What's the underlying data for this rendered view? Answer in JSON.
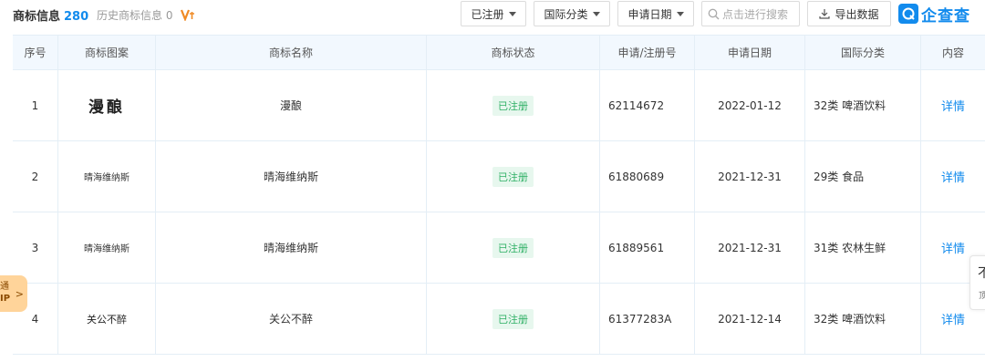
{
  "header": {
    "tab_active_label": "商标信息",
    "tab_active_count": "280",
    "tab_history_label": "历史商标信息 0",
    "filter_status": "已注册",
    "filter_class": "国际分类",
    "filter_date": "申请日期",
    "search_placeholder": "点击进行搜索",
    "export_label": "导出数据",
    "brand_name": "企查查"
  },
  "columns": [
    "序号",
    "商标图案",
    "商标名称",
    "商标状态",
    "申请/注册号",
    "申请日期",
    "国际分类",
    "内容"
  ],
  "rows": [
    {
      "index": "1",
      "image_text": "漫酿",
      "name": "漫酿",
      "status": "已注册",
      "reg_no": "62114672",
      "date": "2022-01-12",
      "class": "32类 啤酒饮料",
      "action": "详情"
    },
    {
      "index": "2",
      "image_text": "晴海维纳斯",
      "name": "晴海维纳斯",
      "status": "已注册",
      "reg_no": "61880689",
      "date": "2021-12-31",
      "class": "29类 食品",
      "action": "详情"
    },
    {
      "index": "3",
      "image_text": "晴海维纳斯",
      "name": "晴海维纳斯",
      "status": "已注册",
      "reg_no": "61889561",
      "date": "2021-12-31",
      "class": "31类 农林生鲜",
      "action": "详情"
    },
    {
      "index": "4",
      "image_text": "关公不醉",
      "name": "关公不醉",
      "status": "已注册",
      "reg_no": "61377283A",
      "date": "2021-12-14",
      "class": "32类 啤酒饮料",
      "action": "详情"
    }
  ],
  "float_left": {
    "line1": "通",
    "line2": "IP"
  },
  "float_right": {
    "line1": "不",
    "line2": "顶"
  },
  "colors": {
    "accent": "#128bed",
    "status_green": "#2fb065",
    "status_bg": "#e7f7ee",
    "header_bg": "#f2f8fe"
  }
}
